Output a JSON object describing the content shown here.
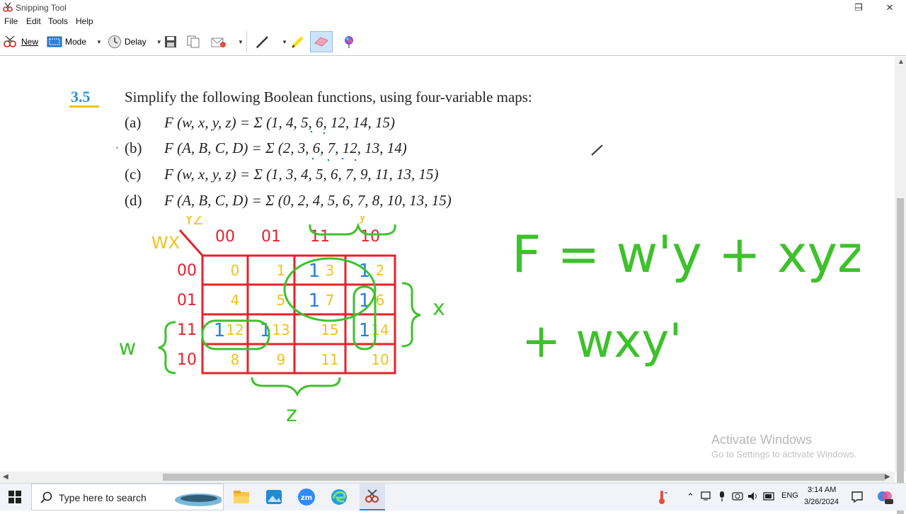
{
  "window": {
    "title": "Snipping Tool",
    "minimize": "─",
    "restore": "❐",
    "close": "✕"
  },
  "menu": [
    "File",
    "Edit",
    "Tools",
    "Help"
  ],
  "toolbar": {
    "new_label": "New",
    "mode_label": "Mode",
    "delay_label": "Delay"
  },
  "problem": {
    "number": "3.5",
    "heading": "Simplify the following Boolean functions, using four-variable maps:",
    "items": [
      {
        "label": "(a)",
        "expr": "F (w, x, y, z) = Σ (1, 4, 5, 6, 12, 14, 15)"
      },
      {
        "label": "(b)",
        "expr": "F (A, B, C, D) = Σ (2, 3, 6, 7, 12, 13, 14)"
      },
      {
        "label": "(c)",
        "expr": "F (w, x, y, z) = Σ (1, 3, 4, 5, 6, 7, 9, 11, 13, 15)"
      },
      {
        "label": "(d)",
        "expr": "F (A, B, C, D) = Σ (0, 2, 4, 5, 6, 7, 8, 10, 13, 15)"
      }
    ]
  },
  "kmap": {
    "corner_row_var": "WX",
    "corner_col_var": "YZ",
    "col_headers": [
      "00",
      "01",
      "11",
      "10"
    ],
    "row_headers": [
      "00",
      "01",
      "11",
      "10"
    ],
    "cells": [
      [
        "0",
        "1",
        "3",
        "2"
      ],
      [
        "4",
        "5",
        "7",
        "6"
      ],
      [
        "12",
        "13",
        "15",
        "14"
      ],
      [
        "8",
        "9",
        "11",
        "10"
      ]
    ],
    "ones": [
      [
        "",
        "",
        "1",
        "1"
      ],
      [
        "",
        "",
        "1",
        "1"
      ],
      [
        "1",
        "1",
        "",
        "1"
      ],
      [
        "",
        "",
        "",
        ""
      ]
    ],
    "brace_y": "y",
    "brace_x": "x",
    "brace_w": "w",
    "brace_z": "z"
  },
  "answer": {
    "line1": "F = w'y + xyz'",
    "line2": "+ wxy'"
  },
  "watermark": {
    "title": "Activate Windows",
    "subtitle": "Go to Settings to activate Windows."
  },
  "taskbar": {
    "search_placeholder": "Type here to search",
    "lang": "ENG",
    "time": "3:14 AM",
    "date": "3/26/2024"
  },
  "colors": {
    "grid_red": "#e8202a",
    "hand_yellow": "#f2c21b",
    "hand_blue": "#2a7fd8",
    "hand_green": "#3ec12c",
    "accent": "#2a8fd0"
  }
}
